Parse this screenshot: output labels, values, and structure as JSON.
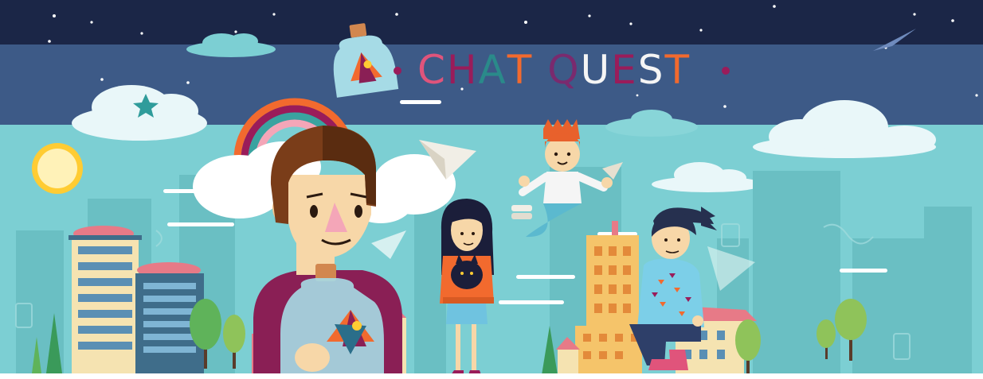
{
  "title": {
    "letters": [
      "C",
      "H",
      "A",
      "T",
      " ",
      "Q",
      "U",
      "E",
      "S",
      "T"
    ],
    "colors": [
      "#e0547b",
      "#9a1c5a",
      "#2a8a8a",
      "#f26a2e",
      "",
      "#7a2a6e",
      "#f5f5f5",
      "#9a1c5a",
      "#f5f5f5",
      "#f26a2e"
    ]
  },
  "colors": {
    "night_sky": "#1b2647",
    "horizon": "#3d5a87",
    "day_sky": "#7ccfd3",
    "accent_orange": "#f26a2e",
    "accent_magenta": "#9a1c5a"
  },
  "icons": [
    "star-icon",
    "sun-icon",
    "rainbow-icon",
    "paper-plane-icon",
    "message-bottle-icon",
    "cloud-icon",
    "tree-icon",
    "building-icon",
    "bird-icon"
  ]
}
